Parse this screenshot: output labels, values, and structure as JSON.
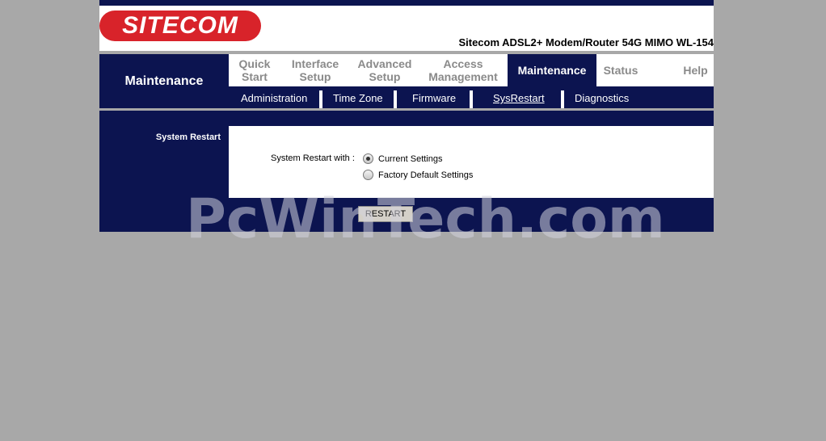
{
  "logo_text": "SITECOM",
  "product_title": "Sitecom ADSL2+ Modem/Router 54G MIMO WL-154",
  "section_title": "Maintenance",
  "tabs": [
    {
      "label": "Quick\nStart",
      "active": false
    },
    {
      "label": "Interface\nSetup",
      "active": false
    },
    {
      "label": "Advanced\nSetup",
      "active": false
    },
    {
      "label": "Access\nManagement",
      "active": false
    },
    {
      "label": "Maintenance",
      "active": true
    },
    {
      "label": "Status",
      "active": false
    },
    {
      "label": "Help",
      "active": false
    }
  ],
  "subnav": [
    {
      "label": "Administration",
      "active": false
    },
    {
      "label": "Time Zone",
      "active": false
    },
    {
      "label": "Firmware",
      "active": false
    },
    {
      "label": "SysRestart",
      "active": true
    },
    {
      "label": "Diagnostics",
      "active": false
    }
  ],
  "content": {
    "label": "System Restart",
    "restart_with_label": "System Restart with :",
    "options": [
      {
        "label": "Current Settings",
        "selected": true
      },
      {
        "label": "Factory Default Settings",
        "selected": false
      }
    ],
    "button_label": "RESTART"
  },
  "watermark": "PcWinTech.com",
  "colors": {
    "navy": "#0c1450",
    "brand_red": "#d8232a",
    "background": "#a8a8a8"
  }
}
